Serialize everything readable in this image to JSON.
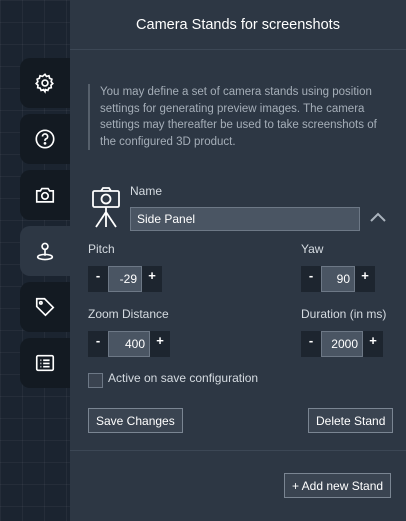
{
  "panel": {
    "title": "Camera Stands for screenshots",
    "description": "You may define a set of camera stands using position settings for generating preview images. The camera settings may thereafter be used to take screenshots of the configured 3D product."
  },
  "sidebar": {
    "items": [
      {
        "icon": "gear-icon",
        "active": false
      },
      {
        "icon": "help-icon",
        "active": false
      },
      {
        "icon": "camera-icon",
        "active": false
      },
      {
        "icon": "location-pin-icon",
        "active": true
      },
      {
        "icon": "tag-icon",
        "active": false
      },
      {
        "icon": "list-icon",
        "active": false
      }
    ]
  },
  "stand": {
    "name_label": "Name",
    "name_value": "Side Panel",
    "pitch": {
      "label": "Pitch",
      "value": "-29",
      "minus": "-",
      "plus": "+"
    },
    "yaw": {
      "label": "Yaw",
      "value": "90",
      "minus": "-",
      "plus": "+"
    },
    "zoom": {
      "label": "Zoom Distance",
      "value": "400",
      "minus": "-",
      "plus": "+"
    },
    "duration": {
      "label": "Duration (in ms)",
      "value": "2000",
      "minus": "-",
      "plus": "+"
    },
    "active_label": "Active on save configuration",
    "active_checked": false
  },
  "buttons": {
    "save": "Save Changes",
    "delete": "Delete Stand",
    "add": "+ Add new Stand"
  }
}
